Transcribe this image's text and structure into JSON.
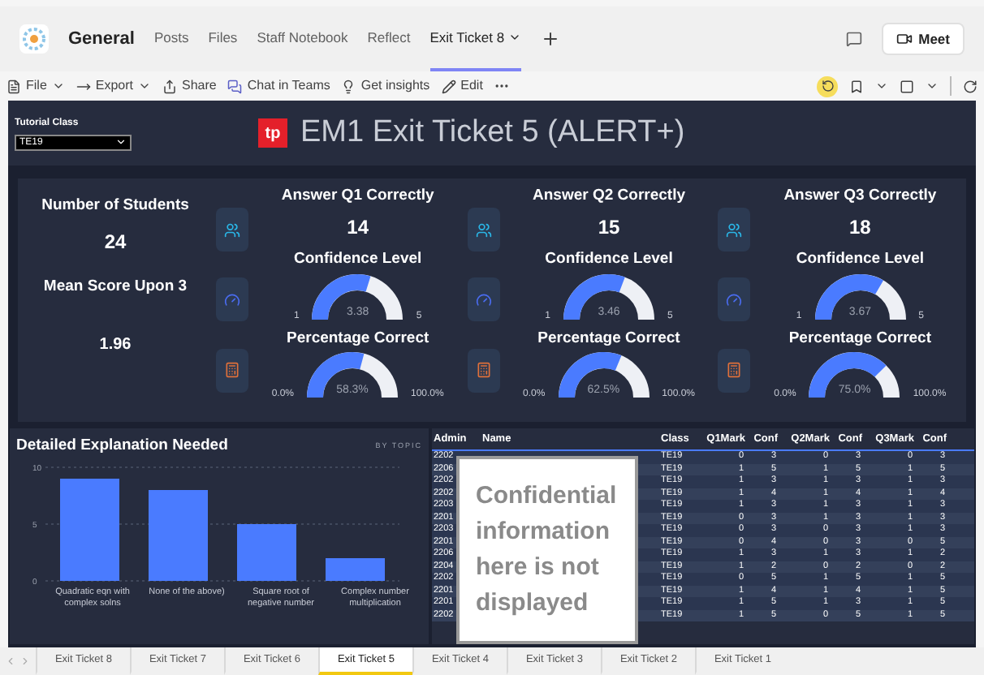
{
  "header": {
    "team": "General",
    "tabs": [
      {
        "label": "Posts",
        "selected": false,
        "caret": false
      },
      {
        "label": "Files",
        "selected": false,
        "caret": false
      },
      {
        "label": "Staff Notebook",
        "selected": false,
        "caret": false
      },
      {
        "label": "Reflect",
        "selected": false,
        "caret": false
      },
      {
        "label": "Exit Ticket 8",
        "selected": true,
        "caret": true
      }
    ],
    "meet": "Meet"
  },
  "toolbar": [
    {
      "label": "File",
      "caret": true
    },
    {
      "label": "Export",
      "caret": true
    },
    {
      "label": "Share",
      "caret": false
    },
    {
      "label": "Chat in Teams",
      "caret": false
    },
    {
      "label": "Get insights",
      "caret": false
    },
    {
      "label": "Edit",
      "caret": false
    }
  ],
  "report": {
    "filter_label": "Tutorial Class",
    "filter_value": "TE19",
    "logo": "tp",
    "title": "EM1 Exit Ticket 5 (ALERT+)"
  },
  "summary": {
    "students_label": "Number of Students",
    "students_value": "24",
    "mean_label": "Mean Score Upon 3",
    "mean_value": "1.96"
  },
  "questions": [
    {
      "answer_label": "Answer Q1 Correctly",
      "answer_value": "14",
      "confidence_label": "Confidence Level",
      "confidence": {
        "min": "1",
        "max": "5",
        "value": "3.38"
      },
      "percentage_label": "Percentage Correct",
      "percentage": {
        "min": "0.0%",
        "max": "100.0%",
        "value": "58.3%"
      }
    },
    {
      "answer_label": "Answer Q2 Correctly",
      "answer_value": "15",
      "confidence_label": "Confidence Level",
      "confidence": {
        "min": "1",
        "max": "5",
        "value": "3.46"
      },
      "percentage_label": "Percentage Correct",
      "percentage": {
        "min": "0.0%",
        "max": "100.0%",
        "value": "62.5%"
      }
    },
    {
      "answer_label": "Answer Q3 Correctly",
      "answer_value": "18",
      "confidence_label": "Confidence Level",
      "confidence": {
        "min": "1",
        "max": "5",
        "value": "3.67"
      },
      "percentage_label": "Percentage Correct",
      "percentage": {
        "min": "0.0%",
        "max": "100.0%",
        "value": "75.0%"
      }
    }
  ],
  "chart_panel": {
    "title": "Detailed Explanation Needed",
    "subtitle": "BY TOPIC",
    "chart_data": {
      "type": "bar",
      "categories": [
        "Quadratic eqn with complex solns",
        "None of the above)",
        "Square root of negative number",
        "Complex number multiplication"
      ],
      "series": [
        {
          "color": "#4a7bff",
          "values": [
            9,
            8,
            5,
            2
          ]
        }
      ],
      "ylim": [
        0,
        10
      ],
      "yticks": [
        0,
        5,
        10
      ]
    }
  },
  "table": {
    "columns": [
      "Admin",
      "Name",
      "Class",
      "Q1Mark",
      "Conf",
      "Q2Mark",
      "Conf",
      "Q3Mark",
      "Conf"
    ],
    "rows": [
      [
        "2202",
        "",
        "TE19",
        "0",
        "3",
        "0",
        "3",
        "0",
        "3"
      ],
      [
        "2206",
        "",
        "TE19",
        "1",
        "5",
        "1",
        "5",
        "1",
        "5"
      ],
      [
        "2202",
        "",
        "TE19",
        "1",
        "3",
        "1",
        "3",
        "1",
        "3"
      ],
      [
        "2202",
        "",
        "TE19",
        "1",
        "4",
        "1",
        "4",
        "1",
        "4"
      ],
      [
        "2203",
        "",
        "TE19",
        "1",
        "3",
        "1",
        "3",
        "1",
        "3"
      ],
      [
        "2201",
        "",
        "TE19",
        "0",
        "3",
        "1",
        "3",
        "1",
        "3"
      ],
      [
        "2203",
        "",
        "TE19",
        "0",
        "3",
        "0",
        "3",
        "1",
        "3"
      ],
      [
        "2201",
        "",
        "TE19",
        "0",
        "4",
        "0",
        "3",
        "0",
        "5"
      ],
      [
        "2206",
        "",
        "TE19",
        "1",
        "3",
        "1",
        "3",
        "1",
        "2"
      ],
      [
        "2204",
        "",
        "TE19",
        "1",
        "2",
        "0",
        "2",
        "0",
        "2"
      ],
      [
        "2202",
        "",
        "TE19",
        "0",
        "5",
        "1",
        "5",
        "1",
        "5"
      ],
      [
        "2201",
        "",
        "TE19",
        "1",
        "4",
        "1",
        "4",
        "1",
        "5"
      ],
      [
        "2201",
        "",
        "TE19",
        "1",
        "5",
        "1",
        "3",
        "1",
        "5"
      ],
      [
        "2202",
        "",
        "TE19",
        "1",
        "5",
        "0",
        "5",
        "1",
        "5"
      ]
    ]
  },
  "overlay_note": "Confidential information here is not displayed",
  "page_tabs": [
    {
      "label": "Exit Ticket 8",
      "selected": false
    },
    {
      "label": "Exit Ticket 7",
      "selected": false
    },
    {
      "label": "Exit Ticket 6",
      "selected": false
    },
    {
      "label": "Exit Ticket 5",
      "selected": true
    },
    {
      "label": "Exit Ticket 4",
      "selected": false
    },
    {
      "label": "Exit Ticket 3",
      "selected": false
    },
    {
      "label": "Exit Ticket 2",
      "selected": false
    },
    {
      "label": "Exit Ticket 1",
      "selected": false
    }
  ]
}
